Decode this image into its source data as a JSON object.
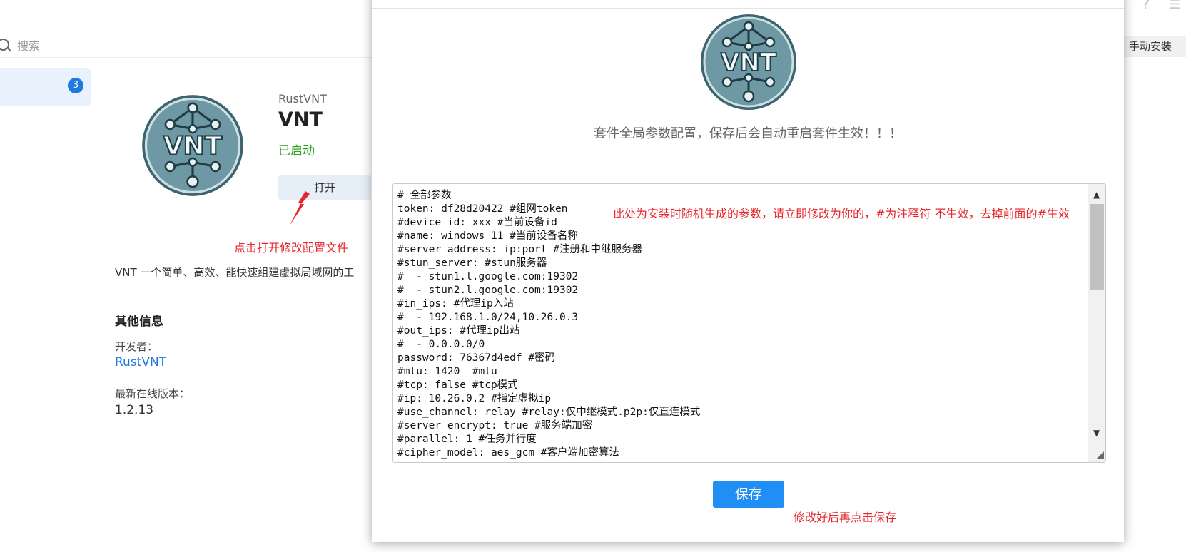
{
  "search": {
    "placeholder": "搜索"
  },
  "toolbar": {
    "manual_install": "手动安装"
  },
  "sidebar": {
    "badge_count": "3"
  },
  "app": {
    "vendor": "RustVNT",
    "title": "VNT",
    "status": "已启动",
    "open_button": "打开",
    "description": "VNT 一个简单、高效、能快速组建虚拟局域网的工",
    "other_info_title": "其他信息",
    "developer_label": "开发者：",
    "developer_link": "RustVNT",
    "latest_version_label": "最新在线版本：",
    "latest_version": "1.2.13",
    "logo_text": "VNT"
  },
  "annotations": {
    "open_hint": "点击打开修改配置文件",
    "params_hint": "此处为安装时随机生成的参数，请立即修改为你的，#为注释符 不生效，去掉前面的#生效",
    "save_hint": "修改好后再点击保存"
  },
  "dialog": {
    "message": "套件全局参数配置，保存后会自动重启套件生效！！！",
    "config_text": "# 全部参数\ntoken: df28d20422 #组网token\n#device_id: xxx #当前设备id\n#name: windows 11 #当前设备名称\n#server_address: ip:port #注册和中继服务器\n#stun_server: #stun服务器\n#  - stun1.l.google.com:19302\n#  - stun2.l.google.com:19302\n#in_ips: #代理ip入站\n#  - 192.168.1.0/24,10.26.0.3\n#out_ips: #代理ip出站\n#  - 0.0.0.0/0\npassword: 76367d4edf #密码\n#mtu: 1420  #mtu\n#tcp: false #tcp模式\n#ip: 10.26.0.2 #指定虚拟ip\n#use_channel: relay #relay:仅中继模式.p2p:仅直连模式\n#server_encrypt: true #服务端加密\n#parallel: 1 #任务并行度\n#cipher_model: aes_gcm #客户端加密算法",
    "save_button": "保存"
  },
  "colors": {
    "accent": "#1f8ef5",
    "running": "#2ea121",
    "annotation": "#e6262b",
    "logo_fill": "#5a8a99"
  }
}
